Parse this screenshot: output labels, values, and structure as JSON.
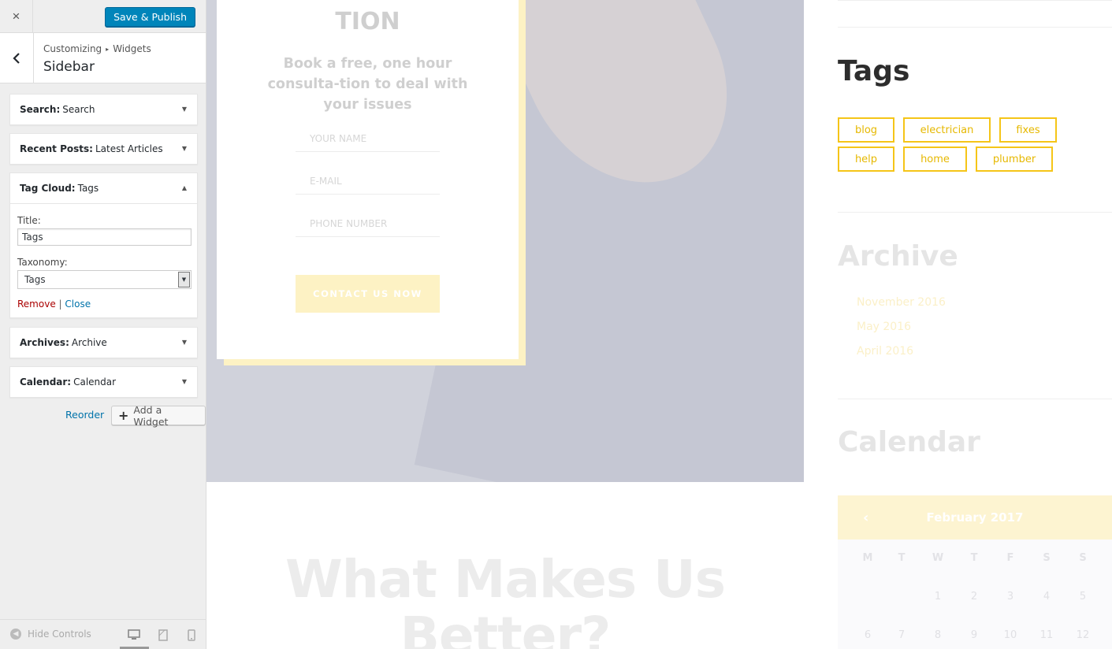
{
  "customizer": {
    "close_label": "×",
    "save_label": "Save & Publish",
    "breadcrumb": {
      "parent": "Customizing",
      "separator": "▸",
      "current": "Widgets"
    },
    "section_title": "Sidebar",
    "widgets": [
      {
        "type": "Search:",
        "title": "Search",
        "expanded": false
      },
      {
        "type": "Recent Posts:",
        "title": "Latest Articles",
        "expanded": false
      },
      {
        "type": "Tag Cloud:",
        "title": "Tags",
        "expanded": true
      },
      {
        "type": "Archives:",
        "title": "Archive",
        "expanded": false
      },
      {
        "type": "Calendar:",
        "title": "Calendar",
        "expanded": false
      }
    ],
    "tag_cloud_form": {
      "title_label": "Title:",
      "title_value": "Tags",
      "taxonomy_label": "Taxonomy:",
      "taxonomy_value": "Tags",
      "remove_label": "Remove",
      "action_separator": "|",
      "close_label": "Close"
    },
    "reorder_label": "Reorder",
    "add_widget_label": "Add a Widget",
    "hide_controls_label": "Hide Controls",
    "preview_device": "desktop"
  },
  "preview": {
    "form": {
      "title": "TION",
      "subtitle": "Book a free, one hour consulta-tion to deal with your issues",
      "name_placeholder": "YOUR NAME",
      "email_placeholder": "E-MAIL",
      "phone_placeholder": "PHONE NUMBER",
      "submit_label": "CONTACT US NOW"
    },
    "section_heading": "What Makes Us Better?",
    "sidebar": {
      "tags_title": "Tags",
      "tags": [
        "blog",
        "electrician",
        "fixes",
        "help",
        "home",
        "plumber"
      ],
      "archive_title": "Archive",
      "archive_items": [
        "November 2016",
        "May 2016",
        "April 2016"
      ],
      "calendar_title": "Calendar",
      "calendar": {
        "month": "February 2017",
        "weekdays": [
          "M",
          "T",
          "W",
          "T",
          "F",
          "S",
          "S"
        ],
        "week1": [
          "",
          "",
          "1",
          "2",
          "3",
          "4",
          "5"
        ],
        "week2": [
          "6",
          "7",
          "8",
          "9",
          "10",
          "11",
          "12"
        ]
      }
    },
    "colors": {
      "accent": "#f5c518",
      "button_primary": "#0085ba",
      "link": "#0073aa",
      "danger": "#a00000"
    }
  }
}
